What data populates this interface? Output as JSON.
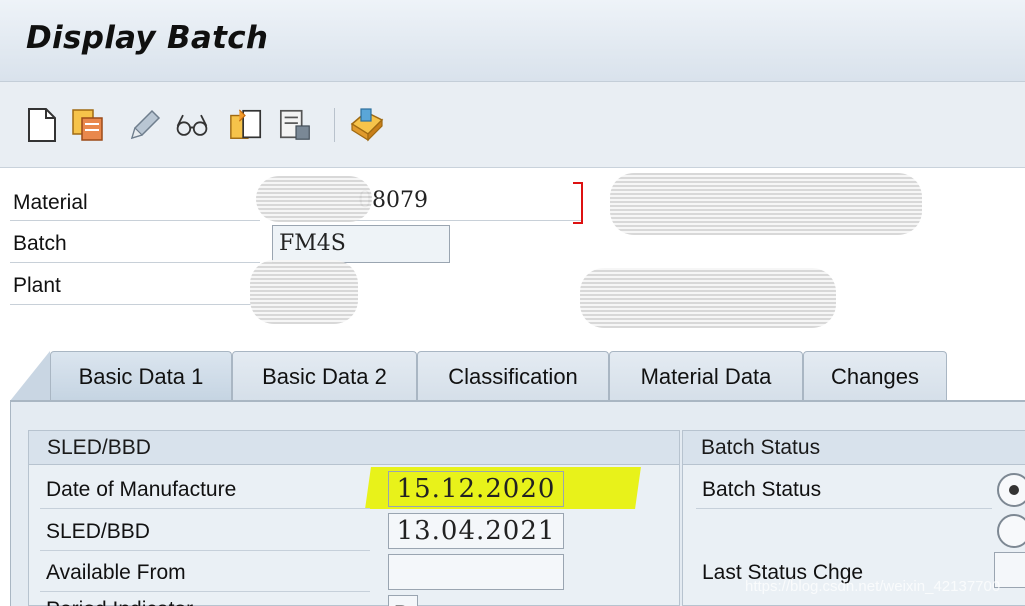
{
  "window": {
    "title": "Display Batch"
  },
  "toolbar": {
    "icons": [
      "new-document-icon",
      "copy-batch-icon",
      "edit-pencil-icon",
      "display-glasses-icon",
      "copy-to-clipboard-icon",
      "delete-icon",
      "other-batch-icon"
    ]
  },
  "header": {
    "material_label": "Material",
    "material_value": "08079",
    "batch_label": "Batch",
    "batch_value": "FM4S",
    "plant_label": "Plant"
  },
  "tabs": [
    {
      "label": "Basic Data 1",
      "active": true
    },
    {
      "label": "Basic Data 2",
      "active": false
    },
    {
      "label": "Classification",
      "active": false
    },
    {
      "label": "Material Data",
      "active": false
    },
    {
      "label": "Changes",
      "active": false
    }
  ],
  "sled_group": {
    "title": "SLED/BBD",
    "rows": [
      {
        "label": "Date of Manufacture",
        "value": "15.12.2020"
      },
      {
        "label": "SLED/BBD",
        "value": "13.04.2021"
      },
      {
        "label": "Available From",
        "value": ""
      },
      {
        "label": "Period Indicator",
        "value": "D"
      }
    ]
  },
  "status_group": {
    "title": "Batch Status",
    "status_label": "Batch Status",
    "last_change_label": "Last Status Chge",
    "radio_selected": 0
  },
  "watermark": "https://blog.csdn.net/weixin_42137700",
  "colors": {
    "highlight": "#e8f21a",
    "required_marker": "#d11111",
    "tab_active": "#c5d4e2"
  }
}
